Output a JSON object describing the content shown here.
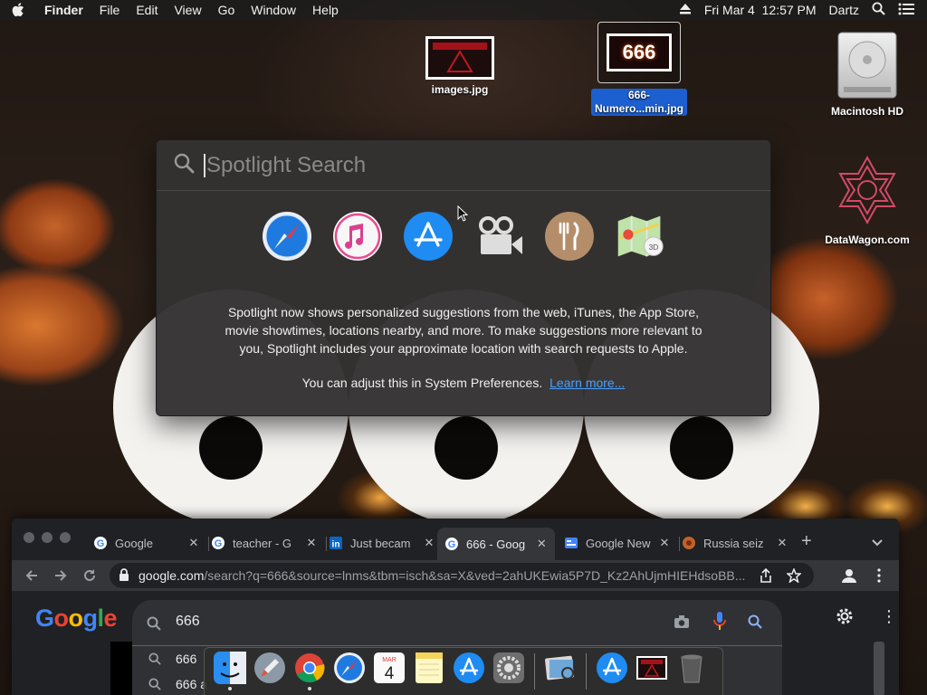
{
  "menubar": {
    "app_name": "Finder",
    "items": [
      "File",
      "Edit",
      "View",
      "Go",
      "Window",
      "Help"
    ],
    "datetime": "Fri Mar 4  12:57 PM",
    "user": "Dartz"
  },
  "desktop": {
    "icons": [
      {
        "label": "images.jpg"
      },
      {
        "label": "666-\nNumero...min.jpg",
        "line1": "666-",
        "line2": "Numero...min.jpg",
        "thumb_text": "666"
      },
      {
        "label": "Macintosh HD"
      },
      {
        "label": "DataWagon.com"
      }
    ]
  },
  "spotlight": {
    "placeholder": "Spotlight Search",
    "apps": [
      "safari",
      "itunes",
      "app-store",
      "movies",
      "restaurants",
      "maps"
    ],
    "message": "Spotlight now shows personalized suggestions from the web, iTunes, the App Store, movie showtimes, locations nearby, and more. To make suggestions more relevant to you, Spotlight includes your approximate location with search requests to Apple.",
    "adjust_text": "You can adjust this in System Preferences.",
    "learn_more": "Learn more..."
  },
  "chrome": {
    "tabs": [
      {
        "title": "Google",
        "favicon": "google",
        "active": false
      },
      {
        "title": "teacher - G",
        "favicon": "google",
        "active": false
      },
      {
        "title": "Just becam",
        "favicon": "linkedin",
        "active": false
      },
      {
        "title": "666 - Goog",
        "favicon": "google",
        "active": true
      },
      {
        "title": "Google New",
        "favicon": "google-news",
        "active": false
      },
      {
        "title": "Russia seiz",
        "favicon": "news",
        "active": false
      }
    ],
    "url_domain": "google.com",
    "url_path": "/search?q=666&source=lnms&tbm=isch&sa=X&ved=2ahUKEwia5P7D_Kz2AhUjmHIEHdsoBB..."
  },
  "google": {
    "logo": "Google",
    "query": "666",
    "suggestions": [
      "666",
      "666 a"
    ]
  },
  "dock": {
    "apps": [
      "finder",
      "launchpad",
      "chrome",
      "safari",
      "calendar",
      "notes",
      "app-store",
      "system-preferences",
      "preview",
      "app-store-2",
      "image-thumb",
      "trash"
    ],
    "calendar_month": "MAR",
    "calendar_day": "4"
  }
}
